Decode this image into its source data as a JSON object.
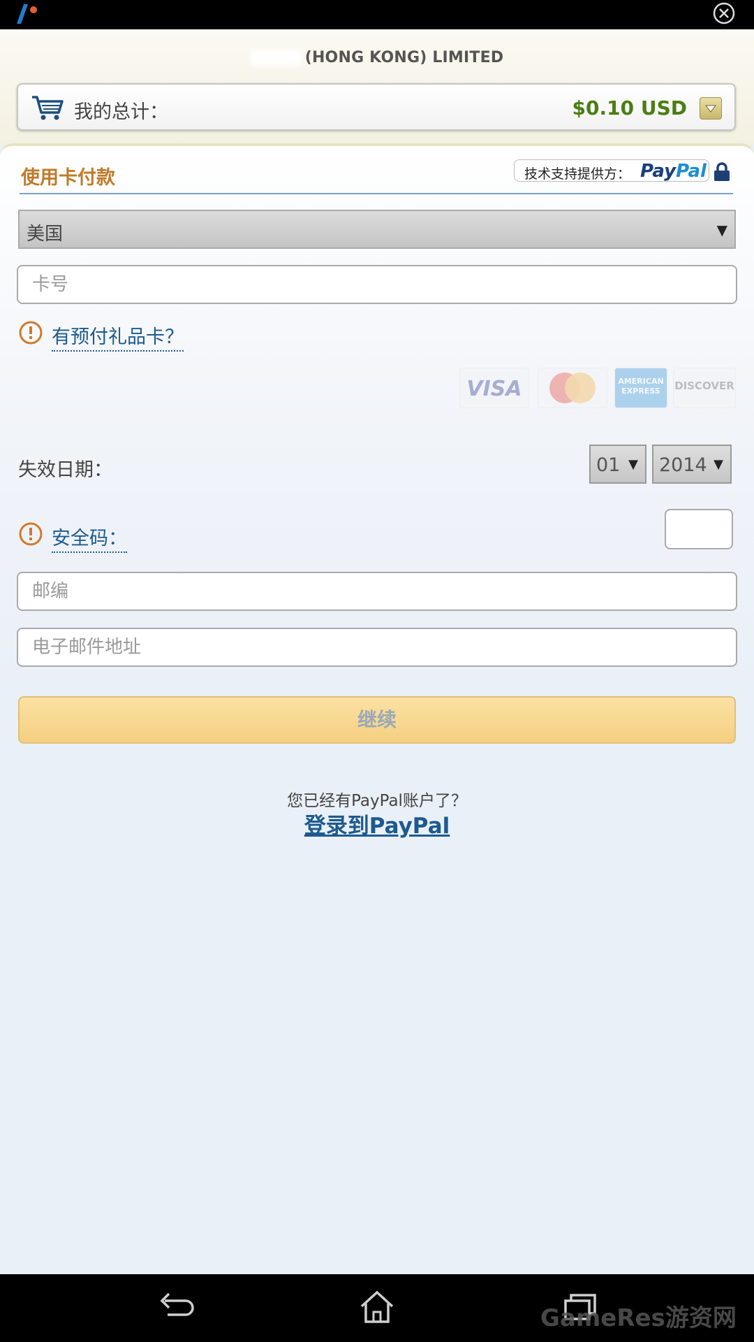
{
  "merchant": {
    "name": "(HONG KONG) LIMITED"
  },
  "order": {
    "total_label": "我的总计：",
    "amount": "$0.10 USD"
  },
  "section": {
    "title": "使用卡付款",
    "powered_label": "技术支持提供方：",
    "powered_brand_pay": "Pay",
    "powered_brand_pal": "Pal"
  },
  "form": {
    "country": "美国",
    "card_number_placeholder": "卡号",
    "gift_card_link": "有预付礼品卡？",
    "expiration_label": "失效日期：",
    "exp_month": "01",
    "exp_year": "2014",
    "security_code_link": "安全码：",
    "postal_placeholder": "邮编",
    "email_placeholder": "电子邮件地址",
    "continue_label": "继续"
  },
  "cards": {
    "visa": "VISA",
    "amex": "AMERICAN EXPRESS",
    "discover": "DISCOVER"
  },
  "login": {
    "prompt": "您已经有PayPal账户了？",
    "link": "登录到PayPal"
  },
  "watermark": "GameRes游资网",
  "colors": {
    "accent_orange": "#c07a2a",
    "amount_green": "#4b7d12",
    "link_blue": "#1d5a8e",
    "button_yellow": "#f5cf80"
  },
  "icons": [
    "close-icon",
    "cart-icon",
    "dropdown-toggle-icon",
    "lock-icon",
    "info-icon",
    "back-icon",
    "home-icon",
    "recent-apps-icon"
  ]
}
